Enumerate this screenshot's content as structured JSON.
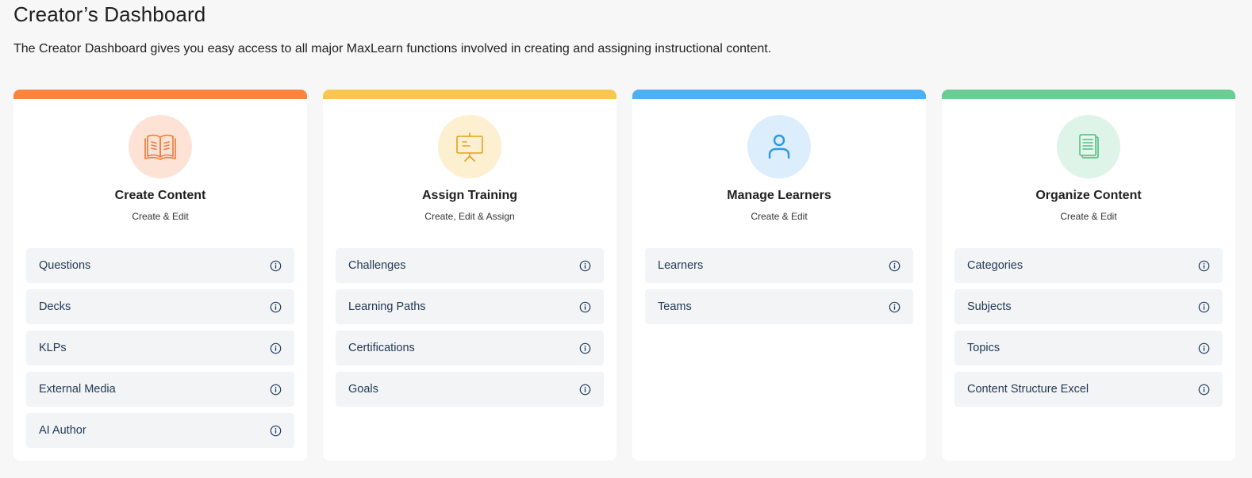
{
  "header": {
    "title": "Creator’s Dashboard",
    "description": "The Creator Dashboard gives you easy access to all major MaxLearn functions involved in creating and assigning instructional content."
  },
  "cards": [
    {
      "title": "Create Content",
      "subtitle": "Create & Edit",
      "accent": "#fb833c",
      "icon_bg": "#fde3d6",
      "icon": "open-book-icon",
      "items": [
        {
          "label": "Questions"
        },
        {
          "label": "Decks"
        },
        {
          "label": "KLPs"
        },
        {
          "label": "External Media"
        },
        {
          "label": "AI Author"
        }
      ]
    },
    {
      "title": "Assign Training",
      "subtitle": "Create, Edit & Assign",
      "accent": "#f9c74f",
      "icon_bg": "#fdf0d1",
      "icon": "presentation-board-icon",
      "items": [
        {
          "label": "Challenges"
        },
        {
          "label": "Learning Paths"
        },
        {
          "label": "Certifications"
        },
        {
          "label": "Goals"
        }
      ]
    },
    {
      "title": "Manage Learners",
      "subtitle": "Create & Edit",
      "accent": "#4db0f5",
      "icon_bg": "#dcedfb",
      "icon": "user-icon",
      "items": [
        {
          "label": "Learners"
        },
        {
          "label": "Teams"
        }
      ]
    },
    {
      "title": "Organize Content",
      "subtitle": "Create & Edit",
      "accent": "#6acd93",
      "icon_bg": "#dff4e8",
      "icon": "documents-icon",
      "items": [
        {
          "label": "Categories"
        },
        {
          "label": "Subjects"
        },
        {
          "label": "Topics"
        },
        {
          "label": "Content Structure Excel"
        }
      ]
    }
  ]
}
